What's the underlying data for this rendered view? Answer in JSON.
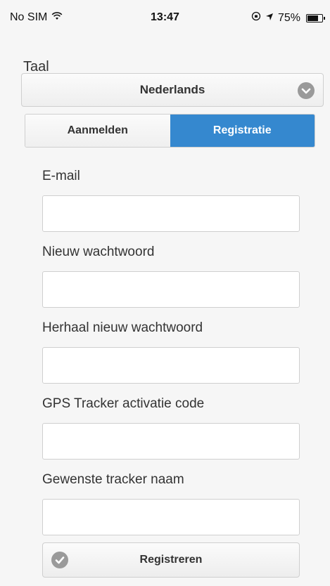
{
  "status_bar": {
    "carrier": "No SIM",
    "time": "13:47",
    "battery_percent": "75%",
    "battery_level": 0.75
  },
  "language": {
    "label": "Taal",
    "selected": "Nederlands"
  },
  "tabs": [
    {
      "label": "Aanmelden",
      "active": false
    },
    {
      "label": "Registratie",
      "active": true
    }
  ],
  "form": {
    "fields": [
      {
        "label": "E-mail",
        "value": ""
      },
      {
        "label": "Nieuw wachtwoord",
        "value": ""
      },
      {
        "label": "Herhaal nieuw wachtwoord",
        "value": ""
      },
      {
        "label": "GPS Tracker activatie code",
        "value": ""
      },
      {
        "label": "Gewenste tracker naam",
        "value": ""
      }
    ],
    "submit_label": "Registreren"
  },
  "colors": {
    "accent": "#3588cf",
    "background": "#f6f6f6"
  }
}
